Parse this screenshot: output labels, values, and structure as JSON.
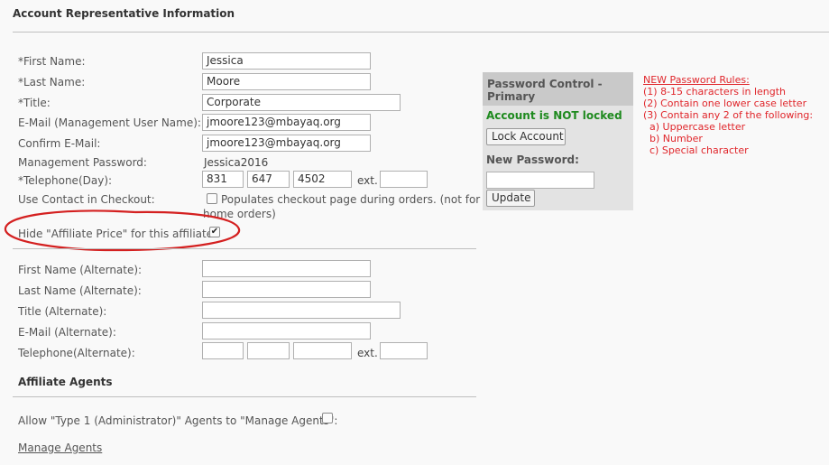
{
  "header": {
    "title": "Account Representative Information"
  },
  "primary": {
    "first_name": {
      "label": "*First Name:",
      "value": "Jessica"
    },
    "last_name": {
      "label": "*Last Name:",
      "value": "Moore"
    },
    "title": {
      "label": "*Title:",
      "value": "Corporate"
    },
    "email": {
      "label": "E-Mail (Management User Name):",
      "value": "jmoore123@mbayaq.org"
    },
    "confirm_email": {
      "label": "Confirm E-Mail:",
      "value": "jmoore123@mbayaq.org"
    },
    "mgmt_password": {
      "label": "Management Password:",
      "value": "Jessica2016"
    },
    "telephone": {
      "label": "*Telephone(Day):",
      "area": "831",
      "prefix": "647",
      "line": "4502",
      "ext_label": "ext.",
      "ext": ""
    },
    "use_contact": {
      "label": "Use Contact in Checkout:",
      "checked": false,
      "desc_line1": "Populates checkout page during orders. (not for at-",
      "desc_line2": "home orders)"
    },
    "hide_affiliate_price": {
      "label": "Hide \"Affiliate Price\" for this affiliate:",
      "checked": true,
      "mark": "✔"
    }
  },
  "alternate": {
    "first_name": {
      "label": "First Name (Alternate):",
      "value": ""
    },
    "last_name": {
      "label": "Last Name (Alternate):",
      "value": ""
    },
    "title": {
      "label": "Title (Alternate):",
      "value": ""
    },
    "email": {
      "label": "E-Mail (Alternate):",
      "value": ""
    },
    "telephone": {
      "label": "Telephone(Alternate):",
      "area": "",
      "prefix": "",
      "line": "",
      "ext_label": "ext.",
      "ext": ""
    }
  },
  "agents": {
    "heading": "Affiliate Agents",
    "allow_label": "Allow \"Type 1 (Administrator)\" Agents to \"Manage Agents\":",
    "allow_checked": false,
    "manage_link": "Manage Agents"
  },
  "password_control": {
    "title_line1": "Password Control -",
    "title_line2": "Primary",
    "status": "Account is NOT locked",
    "lock_button": "Lock Account",
    "new_password_label": "New Password:",
    "new_password_value": "",
    "update_button": "Update"
  },
  "password_rules": {
    "heading": "NEW Password Rules:",
    "rules": [
      "(1) 8-15 characters in length",
      "(2) Contain one lower case letter",
      "(3) Contain any 2 of the following:",
      "a) Uppercase letter",
      "b) Number",
      "c) Special character"
    ]
  },
  "colors": {
    "status_green": "#1e8a1e",
    "rules_red": "#e0262b",
    "annotation_red": "#d42020"
  }
}
